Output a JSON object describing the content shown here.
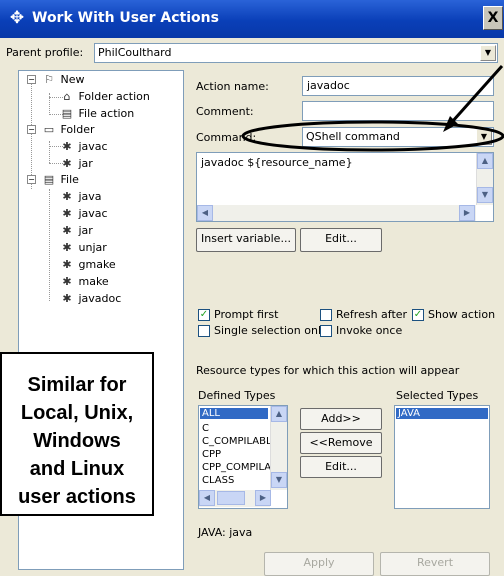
{
  "window": {
    "title": "Work With User Actions",
    "close_label": "X"
  },
  "parent_profile": {
    "label": "Parent profile:",
    "value": "PhilCoulthard"
  },
  "tree": {
    "new": {
      "label": "New",
      "children": [
        "Folder action",
        "File action"
      ]
    },
    "folder": {
      "label": "Folder",
      "children": [
        "javac",
        "jar"
      ]
    },
    "file": {
      "label": "File",
      "children": [
        "java",
        "javac",
        "jar",
        "unjar",
        "gmake",
        "make",
        "javadoc"
      ]
    }
  },
  "form": {
    "action_name_label": "Action name:",
    "action_name_value": "javadoc",
    "comment_label": "Comment:",
    "comment_value": "",
    "command_label": "Command:",
    "command_type": "QShell command",
    "command_text": "javadoc ${resource_name}",
    "insert_variable_label": "Insert variable...",
    "edit_label": "Edit..."
  },
  "options": {
    "prompt_first": {
      "label": "Prompt first",
      "checked": true
    },
    "refresh_after": {
      "label": "Refresh after",
      "checked": false
    },
    "show_action": {
      "label": "Show action",
      "checked": true
    },
    "single_selection": {
      "label": "Single selection only",
      "checked": false
    },
    "invoke_once": {
      "label": "Invoke once",
      "checked": false
    }
  },
  "resource_types": {
    "heading": "Resource types for which this action will appear",
    "defined_label": "Defined Types",
    "selected_label": "Selected Types",
    "defined": [
      "ALL",
      "C",
      "C_COMPILABL",
      "CPP",
      "CPP_COMPILA",
      "CLASS"
    ],
    "selected": [
      "JAVA"
    ],
    "add_label": "Add>>",
    "remove_label": "<<Remove",
    "edit_label": "Edit...",
    "status": "JAVA: java"
  },
  "buttons": {
    "apply": "Apply",
    "revert": "Revert"
  },
  "callout": {
    "lines": [
      "Similar for",
      "Local, Unix,",
      "Windows",
      "and Linux",
      "user actions"
    ]
  },
  "colors": {
    "title_bar": "#0a3fb8",
    "selection": "#316ac5",
    "check": "#21a121"
  }
}
